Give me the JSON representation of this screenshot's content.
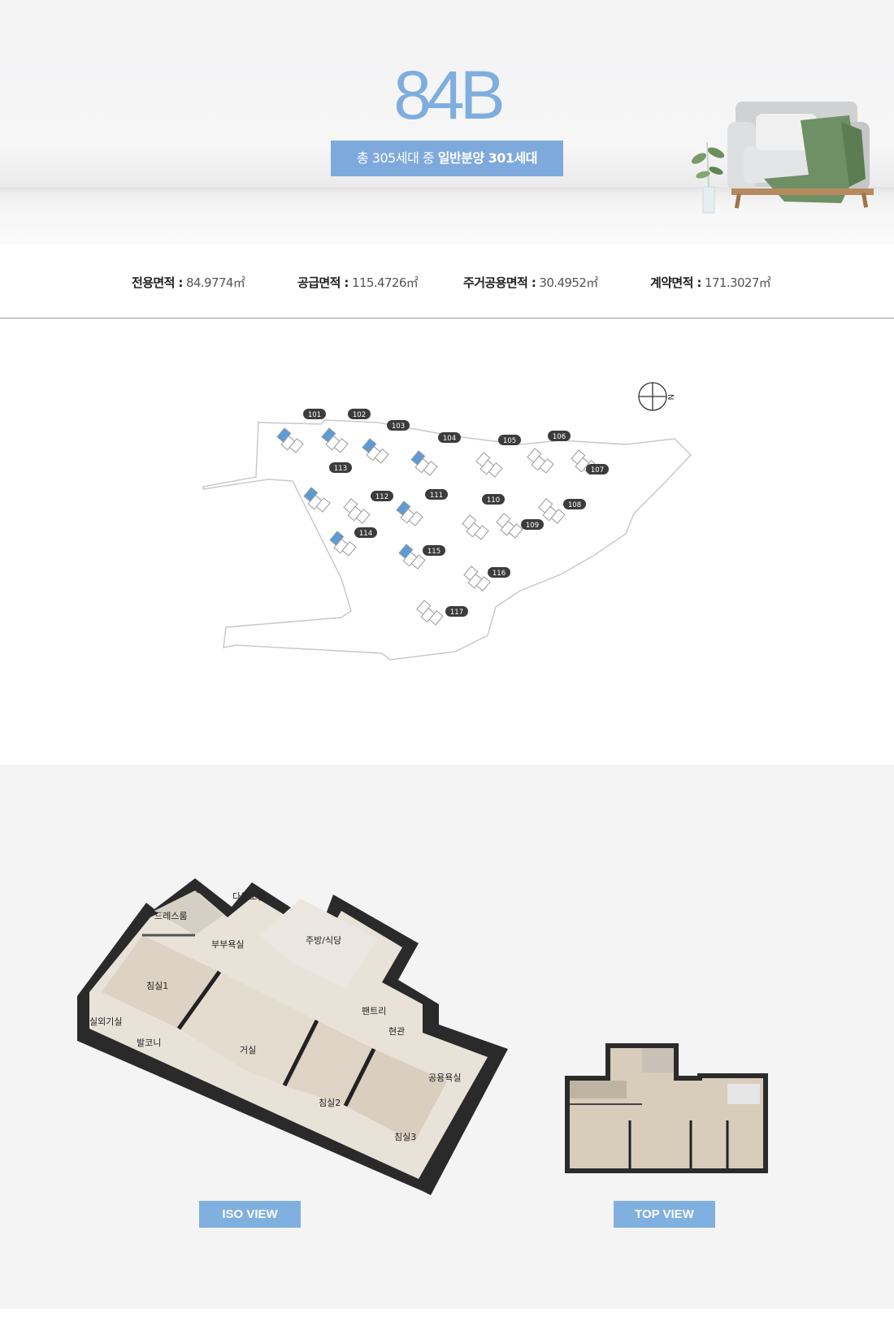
{
  "hero": {
    "title": "84B",
    "badge_prefix": "총 305세대 중 ",
    "badge_strong": "일반분양 301세대"
  },
  "areas": [
    {
      "label": "전용면적 :",
      "value": " 84.9774㎡"
    },
    {
      "label": "공급면적 :",
      "value": " 115.4726㎡"
    },
    {
      "label": "주거공용면적 :",
      "value": " 30.4952㎡"
    },
    {
      "label": "계약면적 :",
      "value": " 171.3027㎡"
    }
  ],
  "site": {
    "compass_label": "N",
    "buildings": [
      "101",
      "102",
      "103",
      "104",
      "105",
      "106",
      "107",
      "108",
      "109",
      "110",
      "111",
      "112",
      "113",
      "114",
      "115",
      "116",
      "117"
    ],
    "highlight_color": "#5b9bd6"
  },
  "plans": {
    "iso_label": "ISO VIEW",
    "top_label": "TOP VIEW",
    "rooms": [
      "다용도실",
      "드레스룸",
      "부부욕실",
      "주방/식당",
      "침실1",
      "팬트리",
      "현관",
      "실외기실",
      "발코니",
      "거실",
      "공용욕실",
      "침실2",
      "침실3"
    ]
  }
}
